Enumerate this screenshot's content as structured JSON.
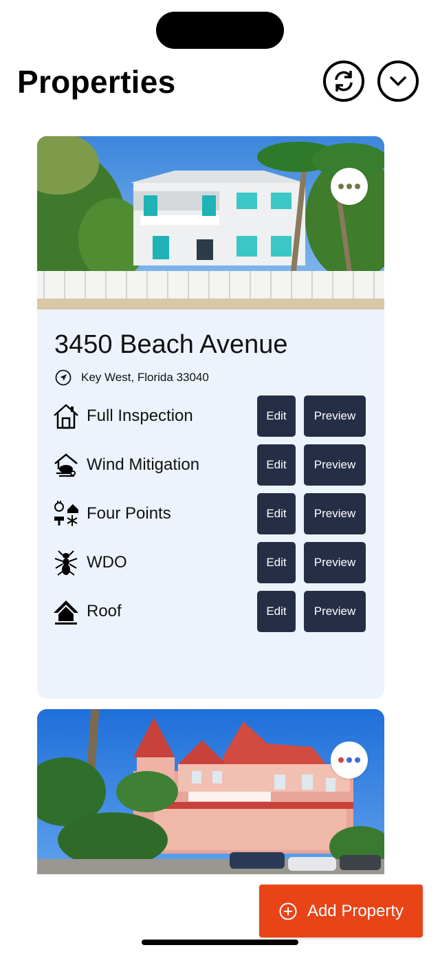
{
  "header": {
    "title": "Properties",
    "sync_icon": "sync-icon",
    "chevron_icon": "chevron-down-icon"
  },
  "properties": [
    {
      "address": "3450 Beach Avenue",
      "location": "Key West, Florida 33040",
      "photo": "white two-story house with teal shutters, palm trees and picket fence",
      "more_dots_color": "#6f7a45",
      "inspections": [
        {
          "label": "Full Inspection",
          "icon": "house-icon",
          "edit": "Edit",
          "preview": "Preview"
        },
        {
          "label": "Wind Mitigation",
          "icon": "wind-house-icon",
          "edit": "Edit",
          "preview": "Preview"
        },
        {
          "label": "Four Points",
          "icon": "utilities-icon",
          "edit": "Edit",
          "preview": "Preview"
        },
        {
          "label": "WDO",
          "icon": "termite-icon",
          "edit": "Edit",
          "preview": "Preview"
        },
        {
          "label": "Roof",
          "icon": "roof-icon",
          "edit": "Edit",
          "preview": "Preview"
        }
      ]
    },
    {
      "photo": "pink Victorian mansion with red roof and palm trees",
      "more_dots_colors": [
        "#d5453a",
        "#3f6dd6",
        "#3f6dd6"
      ]
    }
  ],
  "add_button": {
    "label": "Add Property",
    "icon": "plus-circle-icon"
  },
  "colors": {
    "accent": "#e84418",
    "button": "#262e45",
    "card": "#edf3fd"
  }
}
